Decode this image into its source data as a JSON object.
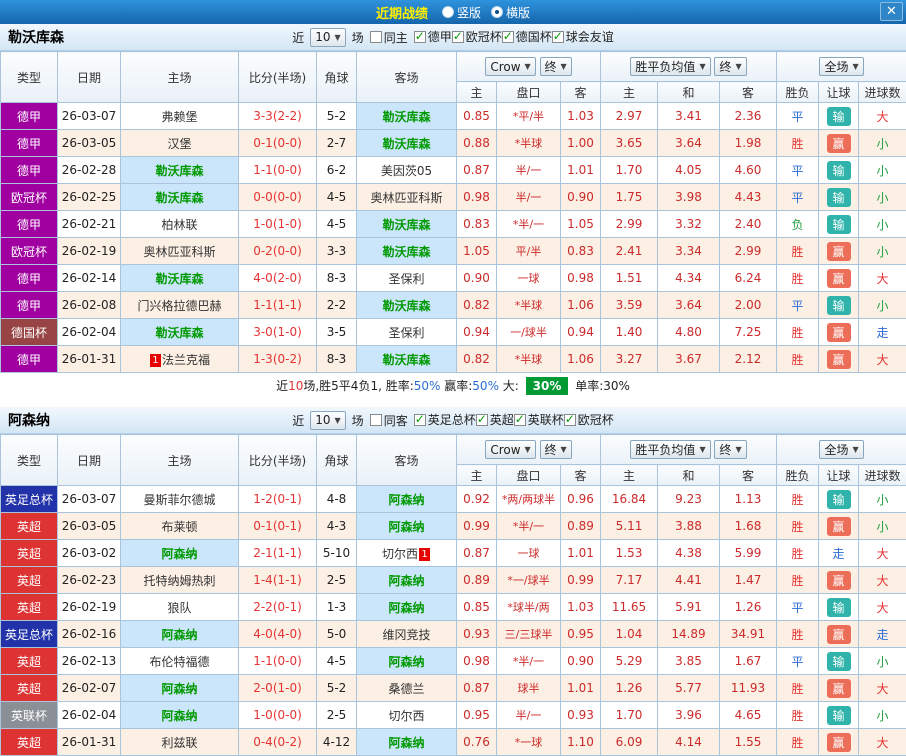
{
  "titlebar": {
    "title": "近期战绩",
    "radio_vertical": "竖版",
    "radio_horizontal": "横版",
    "close": "✕"
  },
  "table_header": {
    "type": "类型",
    "date": "日期",
    "home": "主场",
    "score": "比分(半场)",
    "corner": "角球",
    "away": "客场",
    "bookmaker": "Crow",
    "final": "终",
    "odds_sub": [
      "主",
      "盘口",
      "客"
    ],
    "europe": "胜平负均值",
    "europe_sub": [
      "主",
      "和",
      "客"
    ],
    "scope": "全场",
    "result_sub": [
      "胜负",
      "让球",
      "进球数"
    ]
  },
  "colors": {
    "league": {
      "德甲": "#a000a0",
      "欧冠杯": "#a000a0",
      "德国杯": "#994444",
      "英足总杯": "#2233aa",
      "英超": "#dd3333",
      "英联杯": "#8a9096"
    }
  },
  "sections": [
    {
      "team": "勒沃库森",
      "filter": {
        "near_label": "近",
        "count": "10",
        "games_label": "场",
        "same_label": "同主",
        "same_checked": false,
        "leagues": [
          {
            "label": "德甲",
            "checked": true
          },
          {
            "label": "欧冠杯",
            "checked": true
          },
          {
            "label": "德国杯",
            "checked": true
          },
          {
            "label": "球会友谊",
            "checked": true
          }
        ]
      },
      "rows": [
        {
          "league": "德甲",
          "date": "26-03-07",
          "home": "弗赖堡",
          "home_focus": false,
          "score": "3-3(2-2)",
          "corner": "5-2",
          "away": "勒沃库森",
          "away_focus": true,
          "o1": "0.85",
          "hc": "*平/半",
          "o2": "1.03",
          "e1": "2.97",
          "e2": "3.41",
          "e3": "2.36",
          "res": "平",
          "res_kind": "draw",
          "sp": "输",
          "sp_kind": "lose",
          "goal": "大",
          "goal_kind": "big"
        },
        {
          "league": "德甲",
          "date": "26-03-05",
          "home": "汉堡",
          "home_focus": false,
          "score": "0-1(0-0)",
          "corner": "2-7",
          "away": "勒沃库森",
          "away_focus": true,
          "o1": "0.88",
          "hc": "*半球",
          "o2": "1.00",
          "e1": "3.65",
          "e2": "3.64",
          "e3": "1.98",
          "res": "胜",
          "res_kind": "win",
          "sp": "赢",
          "sp_kind": "win",
          "goal": "小",
          "goal_kind": "small"
        },
        {
          "league": "德甲",
          "date": "26-02-28",
          "home": "勒沃库森",
          "home_focus": true,
          "score": "1-1(0-0)",
          "corner": "6-2",
          "away": "美因茨05",
          "away_focus": false,
          "o1": "0.87",
          "hc": "半/一",
          "o2": "1.01",
          "e1": "1.70",
          "e2": "4.05",
          "e3": "4.60",
          "res": "平",
          "res_kind": "draw",
          "sp": "输",
          "sp_kind": "lose",
          "goal": "小",
          "goal_kind": "small"
        },
        {
          "league": "欧冠杯",
          "date": "26-02-25",
          "home": "勒沃库森",
          "home_focus": true,
          "score": "0-0(0-0)",
          "corner": "4-5",
          "away": "奥林匹亚科斯",
          "away_focus": false,
          "o1": "0.98",
          "hc": "半/一",
          "o2": "0.90",
          "e1": "1.75",
          "e2": "3.98",
          "e3": "4.43",
          "res": "平",
          "res_kind": "draw",
          "sp": "输",
          "sp_kind": "lose",
          "goal": "小",
          "goal_kind": "small"
        },
        {
          "league": "德甲",
          "date": "26-02-21",
          "home": "柏林联",
          "home_focus": false,
          "score": "1-0(1-0)",
          "corner": "4-5",
          "away": "勒沃库森",
          "away_focus": true,
          "o1": "0.83",
          "hc": "*半/一",
          "o2": "1.05",
          "e1": "2.99",
          "e2": "3.32",
          "e3": "2.40",
          "res": "负",
          "res_kind": "lose",
          "sp": "输",
          "sp_kind": "lose",
          "goal": "小",
          "goal_kind": "small"
        },
        {
          "league": "欧冠杯",
          "date": "26-02-19",
          "home": "奥林匹亚科斯",
          "home_focus": false,
          "score": "0-2(0-0)",
          "corner": "3-3",
          "away": "勒沃库森",
          "away_focus": true,
          "o1": "1.05",
          "hc": "平/半",
          "o2": "0.83",
          "e1": "2.41",
          "e2": "3.34",
          "e3": "2.99",
          "res": "胜",
          "res_kind": "win",
          "sp": "赢",
          "sp_kind": "win",
          "goal": "小",
          "goal_kind": "small"
        },
        {
          "league": "德甲",
          "date": "26-02-14",
          "home": "勒沃库森",
          "home_focus": true,
          "score": "4-0(2-0)",
          "corner": "8-3",
          "away": "圣保利",
          "away_focus": false,
          "o1": "0.90",
          "hc": "一球",
          "o2": "0.98",
          "e1": "1.51",
          "e2": "4.34",
          "e3": "6.24",
          "res": "胜",
          "res_kind": "win",
          "sp": "赢",
          "sp_kind": "win",
          "goal": "大",
          "goal_kind": "big"
        },
        {
          "league": "德甲",
          "date": "26-02-08",
          "home": "门兴格拉德巴赫",
          "home_focus": false,
          "score": "1-1(1-1)",
          "corner": "2-2",
          "away": "勒沃库森",
          "away_focus": true,
          "o1": "0.82",
          "hc": "*半球",
          "o2": "1.06",
          "e1": "3.59",
          "e2": "3.64",
          "e3": "2.00",
          "res": "平",
          "res_kind": "draw",
          "sp": "输",
          "sp_kind": "lose",
          "goal": "小",
          "goal_kind": "small"
        },
        {
          "league": "德国杯",
          "date": "26-02-04",
          "home": "勒沃库森",
          "home_focus": true,
          "score": "3-0(1-0)",
          "corner": "3-5",
          "away": "圣保利",
          "away_focus": false,
          "o1": "0.94",
          "hc": "一/球半",
          "o2": "0.94",
          "e1": "1.40",
          "e2": "4.80",
          "e3": "7.25",
          "res": "胜",
          "res_kind": "win",
          "sp": "赢",
          "sp_kind": "win",
          "goal": "走",
          "goal_kind": "walk"
        },
        {
          "league": "德甲",
          "date": "26-01-31",
          "home": "法兰克福",
          "home_rank": "1",
          "home_focus": false,
          "score": "1-3(0-2)",
          "corner": "8-3",
          "away": "勒沃库森",
          "away_focus": true,
          "o1": "0.82",
          "hc": "*半球",
          "o2": "1.06",
          "e1": "3.27",
          "e2": "3.67",
          "e3": "2.12",
          "res": "胜",
          "res_kind": "win",
          "sp": "赢",
          "sp_kind": "win",
          "goal": "大",
          "goal_kind": "big"
        }
      ],
      "summary": [
        {
          "text": "近",
          "style": "plain"
        },
        {
          "text": "10",
          "style": "red"
        },
        {
          "text": "场,胜5平4负1, 胜率:",
          "style": "plain"
        },
        {
          "text": "50%",
          "style": "blue"
        },
        {
          "text": " 赢率:",
          "style": "plain"
        },
        {
          "text": "50%",
          "style": "blue"
        },
        {
          "text": " 大: ",
          "style": "plain"
        },
        {
          "text": "30%",
          "style": "badge"
        },
        {
          "text": " 单率:30%",
          "style": "plain"
        }
      ]
    },
    {
      "team": "阿森纳",
      "filter": {
        "near_label": "近",
        "count": "10",
        "games_label": "场",
        "same_label": "同客",
        "same_checked": false,
        "leagues": [
          {
            "label": "英足总杯",
            "checked": true
          },
          {
            "label": "英超",
            "checked": true
          },
          {
            "label": "英联杯",
            "checked": true
          },
          {
            "label": "欧冠杯",
            "checked": true
          }
        ]
      },
      "rows": [
        {
          "league": "英足总杯",
          "date": "26-03-07",
          "home": "曼斯菲尔德城",
          "home_focus": false,
          "score": "1-2(0-1)",
          "corner": "4-8",
          "away": "阿森纳",
          "away_focus": true,
          "o1": "0.92",
          "hc": "*两/两球半",
          "o2": "0.96",
          "e1": "16.84",
          "e2": "9.23",
          "e3": "1.13",
          "res": "胜",
          "res_kind": "win",
          "sp": "输",
          "sp_kind": "lose",
          "goal": "小",
          "goal_kind": "small"
        },
        {
          "league": "英超",
          "date": "26-03-05",
          "home": "布莱顿",
          "home_focus": false,
          "score": "0-1(0-1)",
          "corner": "4-3",
          "away": "阿森纳",
          "away_focus": true,
          "o1": "0.99",
          "hc": "*半/一",
          "o2": "0.89",
          "e1": "5.11",
          "e2": "3.88",
          "e3": "1.68",
          "res": "胜",
          "res_kind": "win",
          "sp": "赢",
          "sp_kind": "win",
          "goal": "小",
          "goal_kind": "small"
        },
        {
          "league": "英超",
          "date": "26-03-02",
          "home": "阿森纳",
          "home_focus": true,
          "score": "2-1(1-1)",
          "corner": "5-10",
          "away": "切尔西",
          "away_rank": "1",
          "away_focus": false,
          "o1": "0.87",
          "hc": "一球",
          "o2": "1.01",
          "e1": "1.53",
          "e2": "4.38",
          "e3": "5.99",
          "res": "胜",
          "res_kind": "win",
          "sp": "走",
          "sp_kind": "walk",
          "goal": "大",
          "goal_kind": "big"
        },
        {
          "league": "英超",
          "date": "26-02-23",
          "home": "托特纳姆热刺",
          "home_focus": false,
          "score": "1-4(1-1)",
          "corner": "2-5",
          "away": "阿森纳",
          "away_focus": true,
          "o1": "0.89",
          "hc": "*一/球半",
          "o2": "0.99",
          "e1": "7.17",
          "e2": "4.41",
          "e3": "1.47",
          "res": "胜",
          "res_kind": "win",
          "sp": "赢",
          "sp_kind": "win",
          "goal": "大",
          "goal_kind": "big"
        },
        {
          "league": "英超",
          "date": "26-02-19",
          "home": "狼队",
          "home_focus": false,
          "score": "2-2(0-1)",
          "corner": "1-3",
          "away": "阿森纳",
          "away_focus": true,
          "o1": "0.85",
          "hc": "*球半/两",
          "o2": "1.03",
          "e1": "11.65",
          "e2": "5.91",
          "e3": "1.26",
          "res": "平",
          "res_kind": "draw",
          "sp": "输",
          "sp_kind": "lose",
          "goal": "大",
          "goal_kind": "big"
        },
        {
          "league": "英足总杯",
          "date": "26-02-16",
          "home": "阿森纳",
          "home_focus": true,
          "score": "4-0(4-0)",
          "corner": "5-0",
          "away": "维冈竞技",
          "away_focus": false,
          "o1": "0.93",
          "hc": "三/三球半",
          "o2": "0.95",
          "e1": "1.04",
          "e2": "14.89",
          "e3": "34.91",
          "res": "胜",
          "res_kind": "win",
          "sp": "赢",
          "sp_kind": "win",
          "goal": "走",
          "goal_kind": "walk"
        },
        {
          "league": "英超",
          "date": "26-02-13",
          "home": "布伦特福德",
          "home_focus": false,
          "score": "1-1(0-0)",
          "corner": "4-5",
          "away": "阿森纳",
          "away_focus": true,
          "o1": "0.98",
          "hc": "*半/一",
          "o2": "0.90",
          "e1": "5.29",
          "e2": "3.85",
          "e3": "1.67",
          "res": "平",
          "res_kind": "draw",
          "sp": "输",
          "sp_kind": "lose",
          "goal": "小",
          "goal_kind": "small"
        },
        {
          "league": "英超",
          "date": "26-02-07",
          "home": "阿森纳",
          "home_focus": true,
          "score": "2-0(1-0)",
          "corner": "5-2",
          "away": "桑德兰",
          "away_focus": false,
          "o1": "0.87",
          "hc": "球半",
          "o2": "1.01",
          "e1": "1.26",
          "e2": "5.77",
          "e3": "11.93",
          "res": "胜",
          "res_kind": "win",
          "sp": "赢",
          "sp_kind": "win",
          "goal": "大",
          "goal_kind": "big"
        },
        {
          "league": "英联杯",
          "date": "26-02-04",
          "home": "阿森纳",
          "home_focus": true,
          "score": "1-0(0-0)",
          "corner": "2-5",
          "away": "切尔西",
          "away_focus": false,
          "o1": "0.95",
          "hc": "半/一",
          "o2": "0.93",
          "e1": "1.70",
          "e2": "3.96",
          "e3": "4.65",
          "res": "胜",
          "res_kind": "win",
          "sp": "输",
          "sp_kind": "lose",
          "goal": "小",
          "goal_kind": "small"
        },
        {
          "league": "英超",
          "date": "26-01-31",
          "home": "利兹联",
          "home_focus": false,
          "score": "0-4(0-2)",
          "corner": "4-12",
          "away": "阿森纳",
          "away_focus": true,
          "o1": "0.76",
          "hc": "*一球",
          "o2": "1.10",
          "e1": "6.09",
          "e2": "4.14",
          "e3": "1.55",
          "res": "胜",
          "res_kind": "win",
          "sp": "赢",
          "sp_kind": "win",
          "goal": "大",
          "goal_kind": "big"
        }
      ],
      "summary": []
    }
  ]
}
